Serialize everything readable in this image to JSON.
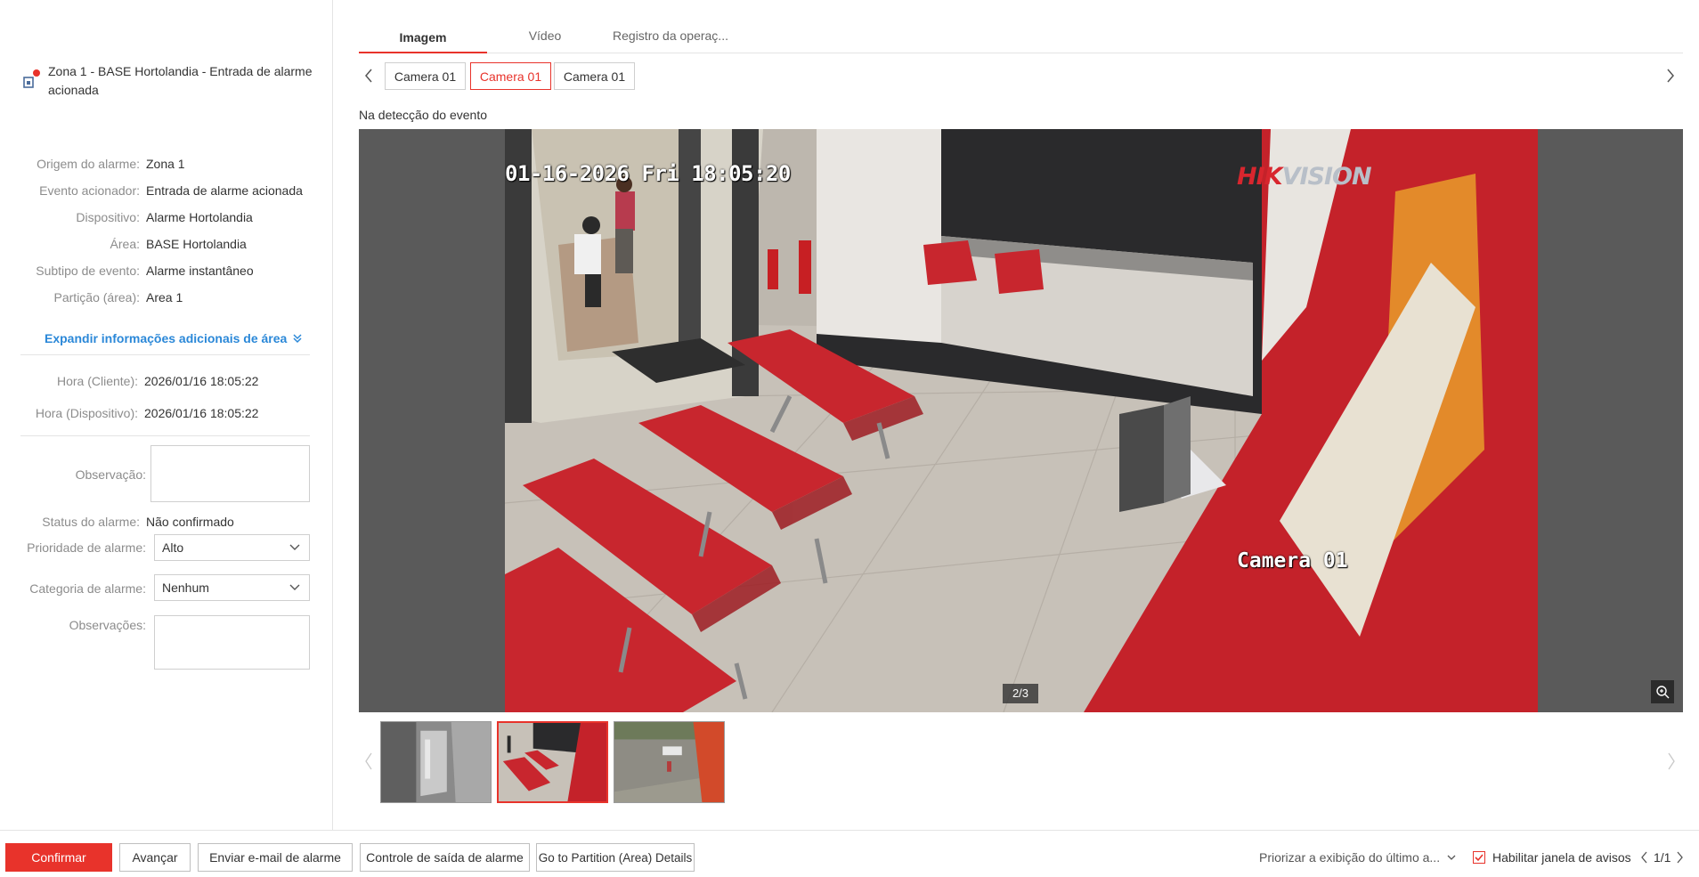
{
  "alarm": {
    "title": "Zona 1 - BASE Hortolandia - Entrada de alarme acionada"
  },
  "details": [
    {
      "label": "Origem do alarme:",
      "value": "Zona 1"
    },
    {
      "label": "Evento acionador:",
      "value": "Entrada de alarme acionada"
    },
    {
      "label": "Dispositivo:",
      "value": "Alarme Hortolandia"
    },
    {
      "label": "Área:",
      "value": "BASE Hortolandia"
    },
    {
      "label": "Subtipo de evento:",
      "value": "Alarme instantâneo"
    },
    {
      "label": "Partição (área):",
      "value": "Area 1"
    }
  ],
  "expand_label": "Expandir informações adicionais de área",
  "times": [
    {
      "label": "Hora (Cliente):",
      "value": "2026/01/16 18:05:22"
    },
    {
      "label": "Hora (Dispositivo):",
      "value": "2026/01/16 18:05:22"
    }
  ],
  "form": {
    "observacao_label": "Observação:",
    "status_label": "Status do alarme:",
    "status_value": "Não confirmado",
    "prioridade_label": "Prioridade de alarme:",
    "prioridade_value": "Alto",
    "categoria_label": "Categoria de alarme:",
    "categoria_value": "Nenhum",
    "observacoes_label": "Observações:"
  },
  "tabs": [
    "Imagem",
    "Vídeo",
    "Registro da operaç..."
  ],
  "cameras": [
    "Camera 01",
    "Camera 01",
    "Camera 01"
  ],
  "detect_label": "Na detecção do evento",
  "viewer": {
    "osd_time": "01-16-2026 Fri 18:05:20",
    "brand_1": "HIK",
    "brand_2": "VISION",
    "osd_camera": "Camera 01",
    "page_indicator": "2/3"
  },
  "footer": {
    "confirm": "Confirmar",
    "advance": "Avançar",
    "email": "Enviar e-mail de alarme",
    "output_control": "Controle de saída de alarme",
    "partition": "Go to Partition (Area) Details",
    "prioritize": "Priorizar a exibição do último a...",
    "enable_window": "Habilitar janela de avisos",
    "pager": "1/1"
  },
  "colors": {
    "accent": "#e8332b",
    "link": "#2b88d8"
  }
}
